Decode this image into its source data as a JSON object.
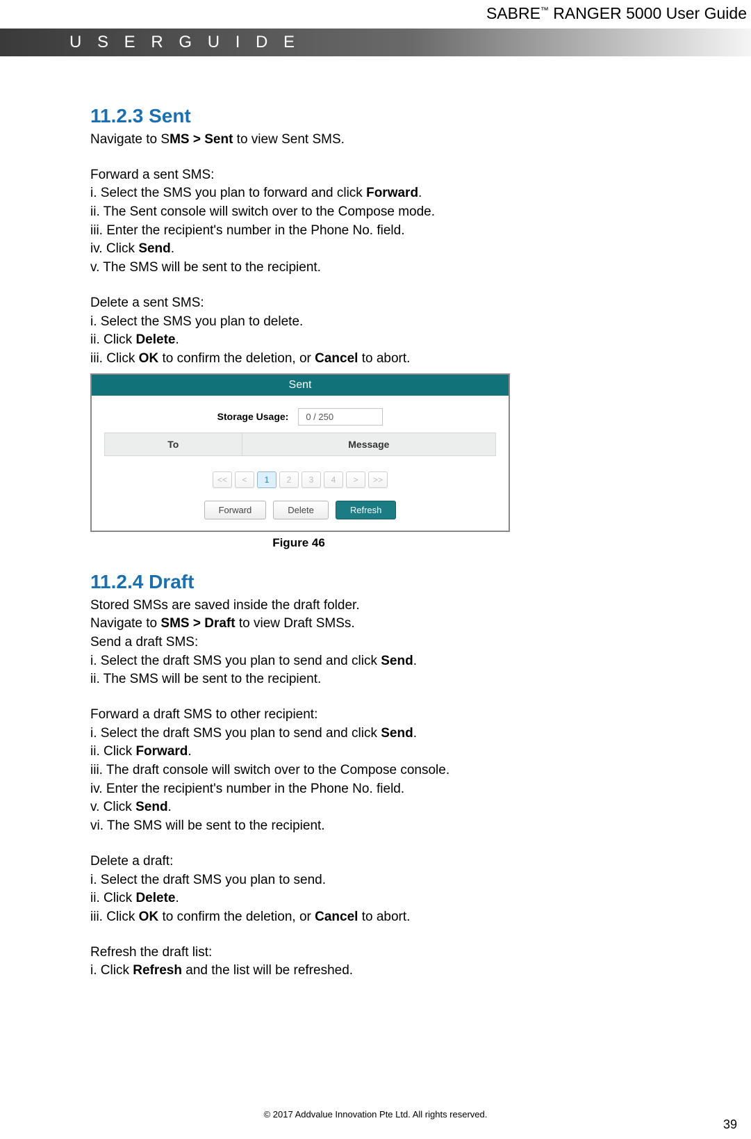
{
  "header": {
    "product_prefix": "SABRE",
    "tm": "™",
    "product_suffix": " RANGER 5000 User Guide",
    "banner": "U S E R   G U I D E"
  },
  "s1": {
    "heading": "11.2.3 Sent",
    "nav_pre": "Navigate to S",
    "nav_bold": "MS > Sent",
    "nav_post": " to view Sent SMS.",
    "fwd_head": "Forward a sent SMS:",
    "fwd_i_pre": "i. Select the SMS you plan to forward and click ",
    "fwd_i_b": "Forward",
    "fwd_i_post": ".",
    "fwd_ii": "ii. The Sent console will switch over to the Compose mode.",
    "fwd_iii": "iii. Enter the recipient's number in the Phone No. field.",
    "fwd_iv_pre": "iv. Click ",
    "fwd_iv_b": "Send",
    "fwd_iv_post": ".",
    "fwd_v": "v. The SMS will be sent to the recipient.",
    "del_head": "Delete a sent SMS:",
    "del_i": "i. Select the SMS you plan to delete.",
    "del_ii_pre": "ii. Click ",
    "del_ii_b": "Delete",
    "del_ii_post": ".",
    "del_iii_pre": "iii. Click ",
    "del_iii_b1": "OK",
    "del_iii_mid": " to confirm the deletion, or ",
    "del_iii_b2": "Cancel",
    "del_iii_post": " to abort."
  },
  "shot": {
    "title": "Sent",
    "storage_label": "Storage Usage:",
    "storage_value": "0 / 250",
    "col_to": "To",
    "col_msg": "Message",
    "pager": {
      "first": "<<",
      "prev": "<",
      "p1": "1",
      "p2": "2",
      "p3": "3",
      "p4": "4",
      "next": ">",
      "last": ">>"
    },
    "btn_fwd": "Forward",
    "btn_del": "Delete",
    "btn_ref": "Refresh",
    "figure": "Figure 46"
  },
  "s2": {
    "heading": "11.2.4 Draft",
    "intro1": "Stored SMSs are saved inside the draft folder.",
    "nav_pre": "Navigate to ",
    "nav_bold": "SMS > Draft",
    "nav_post": " to view Draft SMSs.",
    "send_head": "Send a draft SMS:",
    "send_i_pre": "i. Select the draft SMS you plan to send and click ",
    "send_i_b": "Send",
    "send_i_post": ".",
    "send_ii": "ii. The SMS will be sent to the recipient.",
    "fwd_head": "Forward a draft SMS to other recipient:",
    "fwd_i_pre": "i. Select the draft SMS you plan to send and click ",
    "fwd_i_b": "Send",
    "fwd_i_post": ".",
    "fwd_ii_pre": "ii. Click ",
    "fwd_ii_b": "Forward",
    "fwd_ii_post": ".",
    "fwd_iii": "iii. The draft console will switch over to the Compose console.",
    "fwd_iv": "iv. Enter the recipient's number in the Phone No. field.",
    "fwd_v_pre": "v.  Click ",
    "fwd_v_b": "Send",
    "fwd_v_post": ".",
    "fwd_vi": "vi. The SMS will be sent to the recipient.",
    "del_head": "Delete a draft:",
    "del_i": "i.  Select the draft SMS you plan to send.",
    "del_ii_pre": "ii. Click ",
    "del_ii_b": "Delete",
    "del_ii_post": ".",
    "del_iii_pre": "iii. Click ",
    "del_iii_b1": "OK",
    "del_iii_mid": " to confirm the deletion, or ",
    "del_iii_b2": "Cancel",
    "del_iii_post": " to abort.",
    "ref_head": "Refresh the draft list:",
    "ref_i_pre": "i. Click ",
    "ref_i_b": "Refresh",
    "ref_i_post": " and the list will be refreshed."
  },
  "footer": {
    "copyright": "© 2017 Addvalue Innovation Pte Ltd. All rights reserved.",
    "page": "39"
  }
}
